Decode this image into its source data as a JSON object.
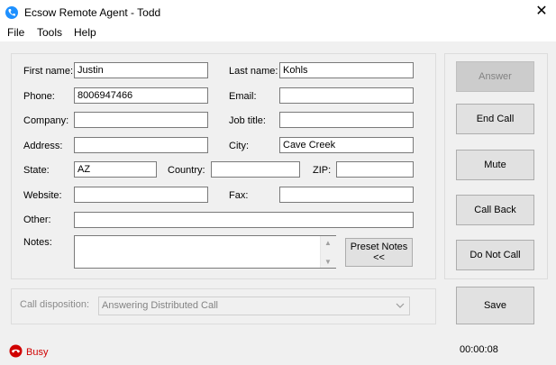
{
  "window": {
    "title": "Ecsow Remote Agent - Todd"
  },
  "menu": [
    "File",
    "Tools",
    "Help"
  ],
  "form": {
    "first_name": {
      "label": "First name:",
      "value": "Justin"
    },
    "last_name": {
      "label": "Last name:",
      "value": "Kohls"
    },
    "phone": {
      "label": "Phone:",
      "value": "8006947466"
    },
    "email": {
      "label": "Email:",
      "value": ""
    },
    "company": {
      "label": "Company:",
      "value": ""
    },
    "job_title": {
      "label": "Job title:",
      "value": ""
    },
    "address": {
      "label": "Address:",
      "value": ""
    },
    "city": {
      "label": "City:",
      "value": "Cave Creek"
    },
    "state": {
      "label": "State:",
      "value": "AZ"
    },
    "country": {
      "label": "Country:",
      "value": ""
    },
    "zip": {
      "label": "ZIP:",
      "value": ""
    },
    "website": {
      "label": "Website:",
      "value": ""
    },
    "fax": {
      "label": "Fax:",
      "value": ""
    },
    "other": {
      "label": "Other:",
      "value": ""
    },
    "notes": {
      "label": "Notes:",
      "value": ""
    },
    "preset_notes_line1": "Preset Notes",
    "preset_notes_line2": "<<"
  },
  "disposition": {
    "label": "Call disposition:",
    "value": "Answering Distributed Call"
  },
  "actions": {
    "answer": "Answer",
    "end_call": "End Call",
    "mute": "Mute",
    "call_back": "Call Back",
    "do_not_call": "Do Not Call",
    "save": "Save"
  },
  "status": {
    "text": "Busy",
    "timer": "00:00:08",
    "status_color": "#d00000"
  },
  "icons": {
    "app": "phone-icon",
    "status": "busy-phone-icon",
    "close": "close-icon",
    "dropdown": "chevron-down-icon"
  }
}
